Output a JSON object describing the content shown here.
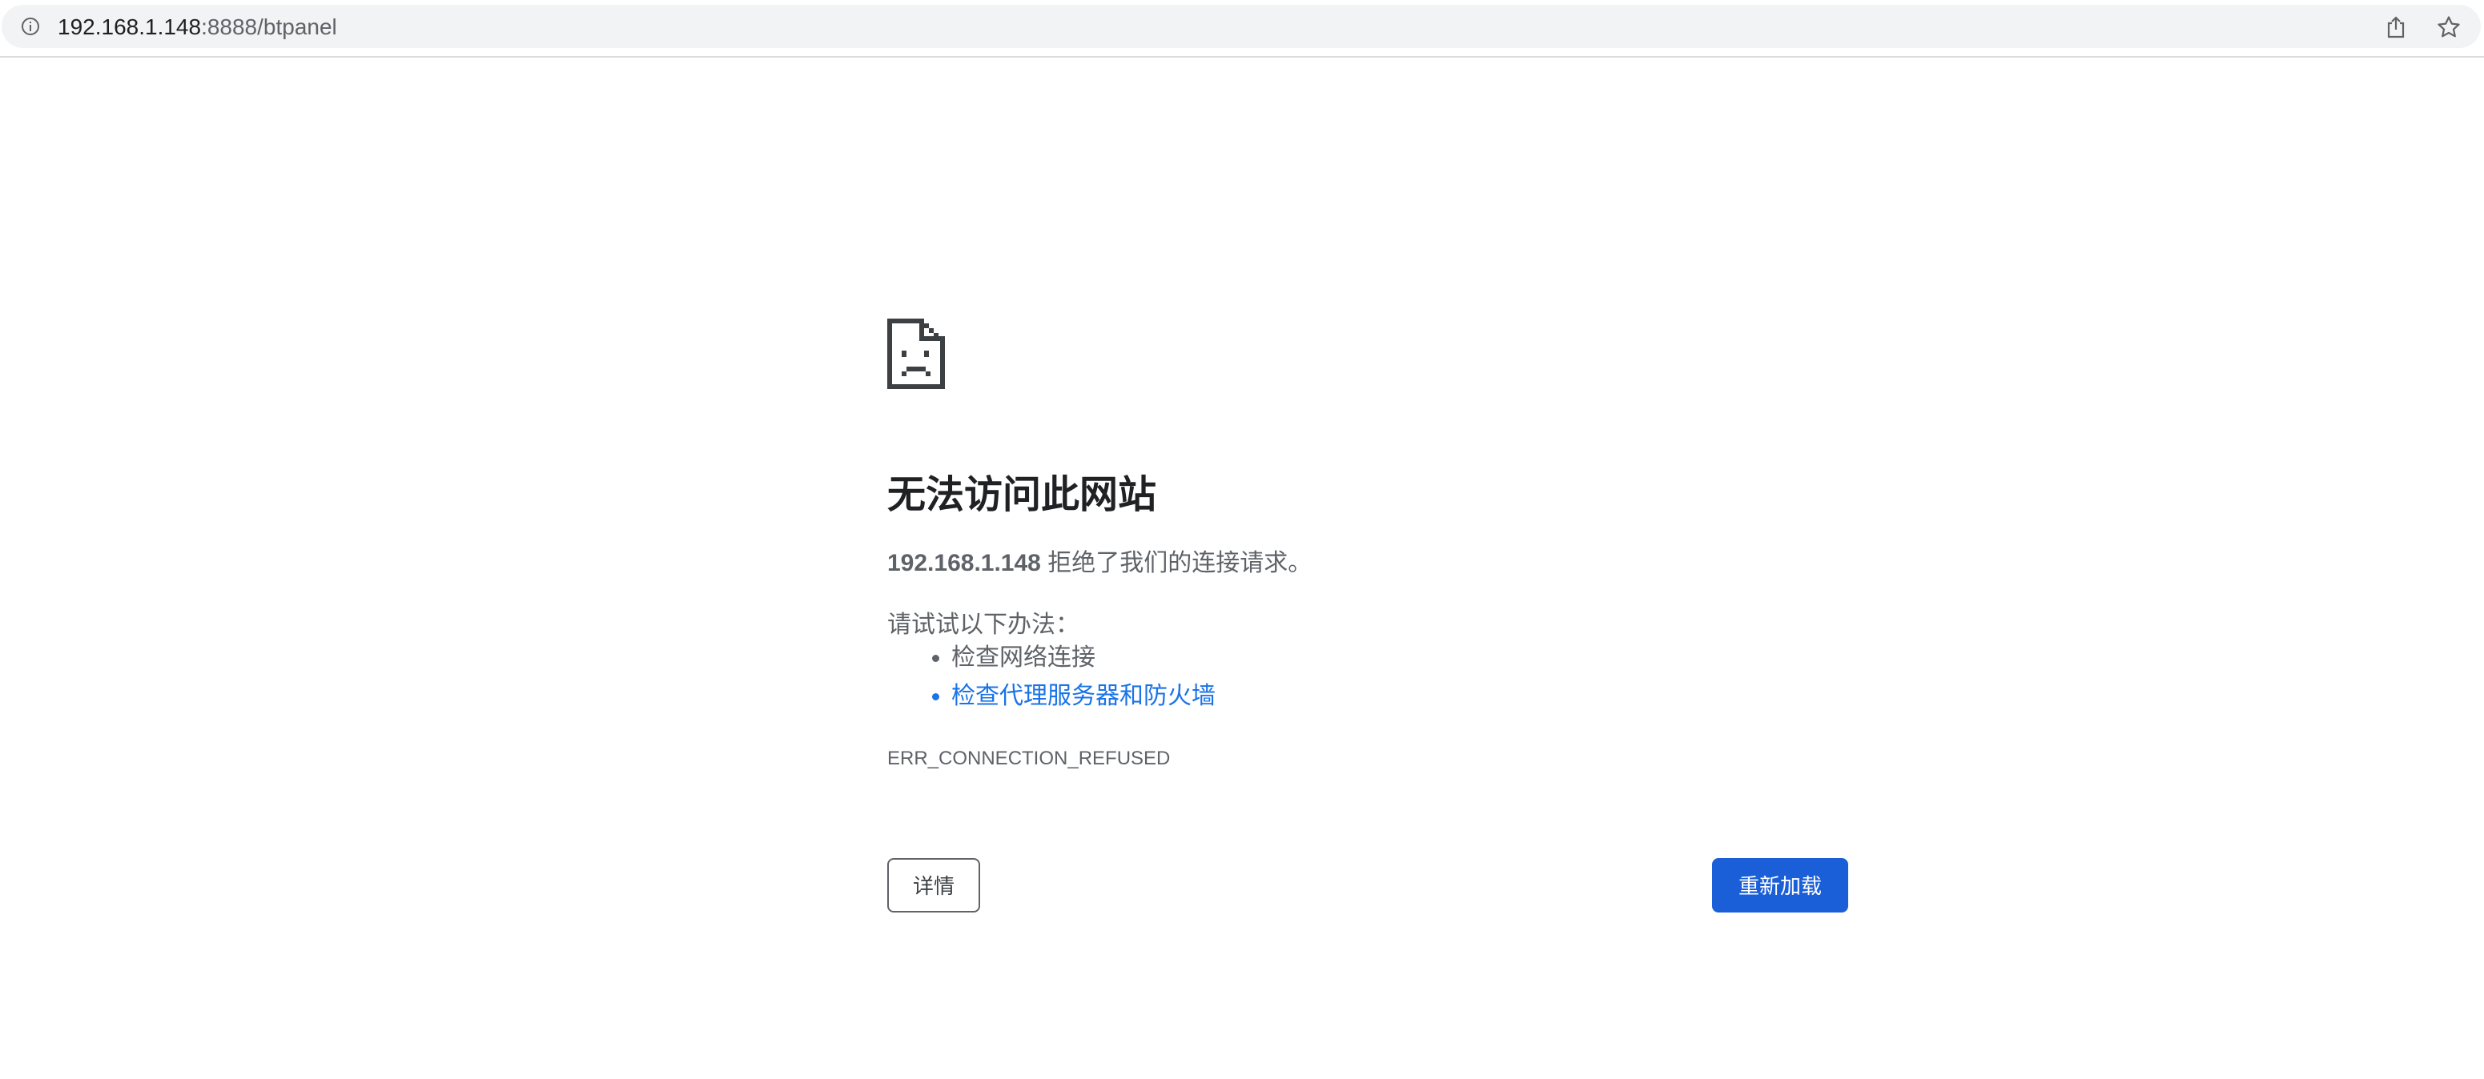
{
  "address_bar": {
    "url_host": "192.168.1.148",
    "url_rest": ":8888/btpanel",
    "info_icon": "info-icon",
    "share_icon": "share-icon",
    "bookmark_icon": "star-icon"
  },
  "error_page": {
    "icon": "sad-document-icon",
    "title": "无法访问此网站",
    "host": "192.168.1.148",
    "message": " 拒绝了我们的连接请求。",
    "suggestions_label": "请试试以下办法：",
    "suggestions": [
      "检查网络连接",
      "检查代理服务器和防火墙"
    ],
    "error_code": "ERR_CONNECTION_REFUSED",
    "details_button": "详情",
    "reload_button": "重新加载"
  },
  "colors": {
    "link": "#1a73e8",
    "primary_button": "#1a5fd8",
    "text_secondary": "#5f6368"
  }
}
